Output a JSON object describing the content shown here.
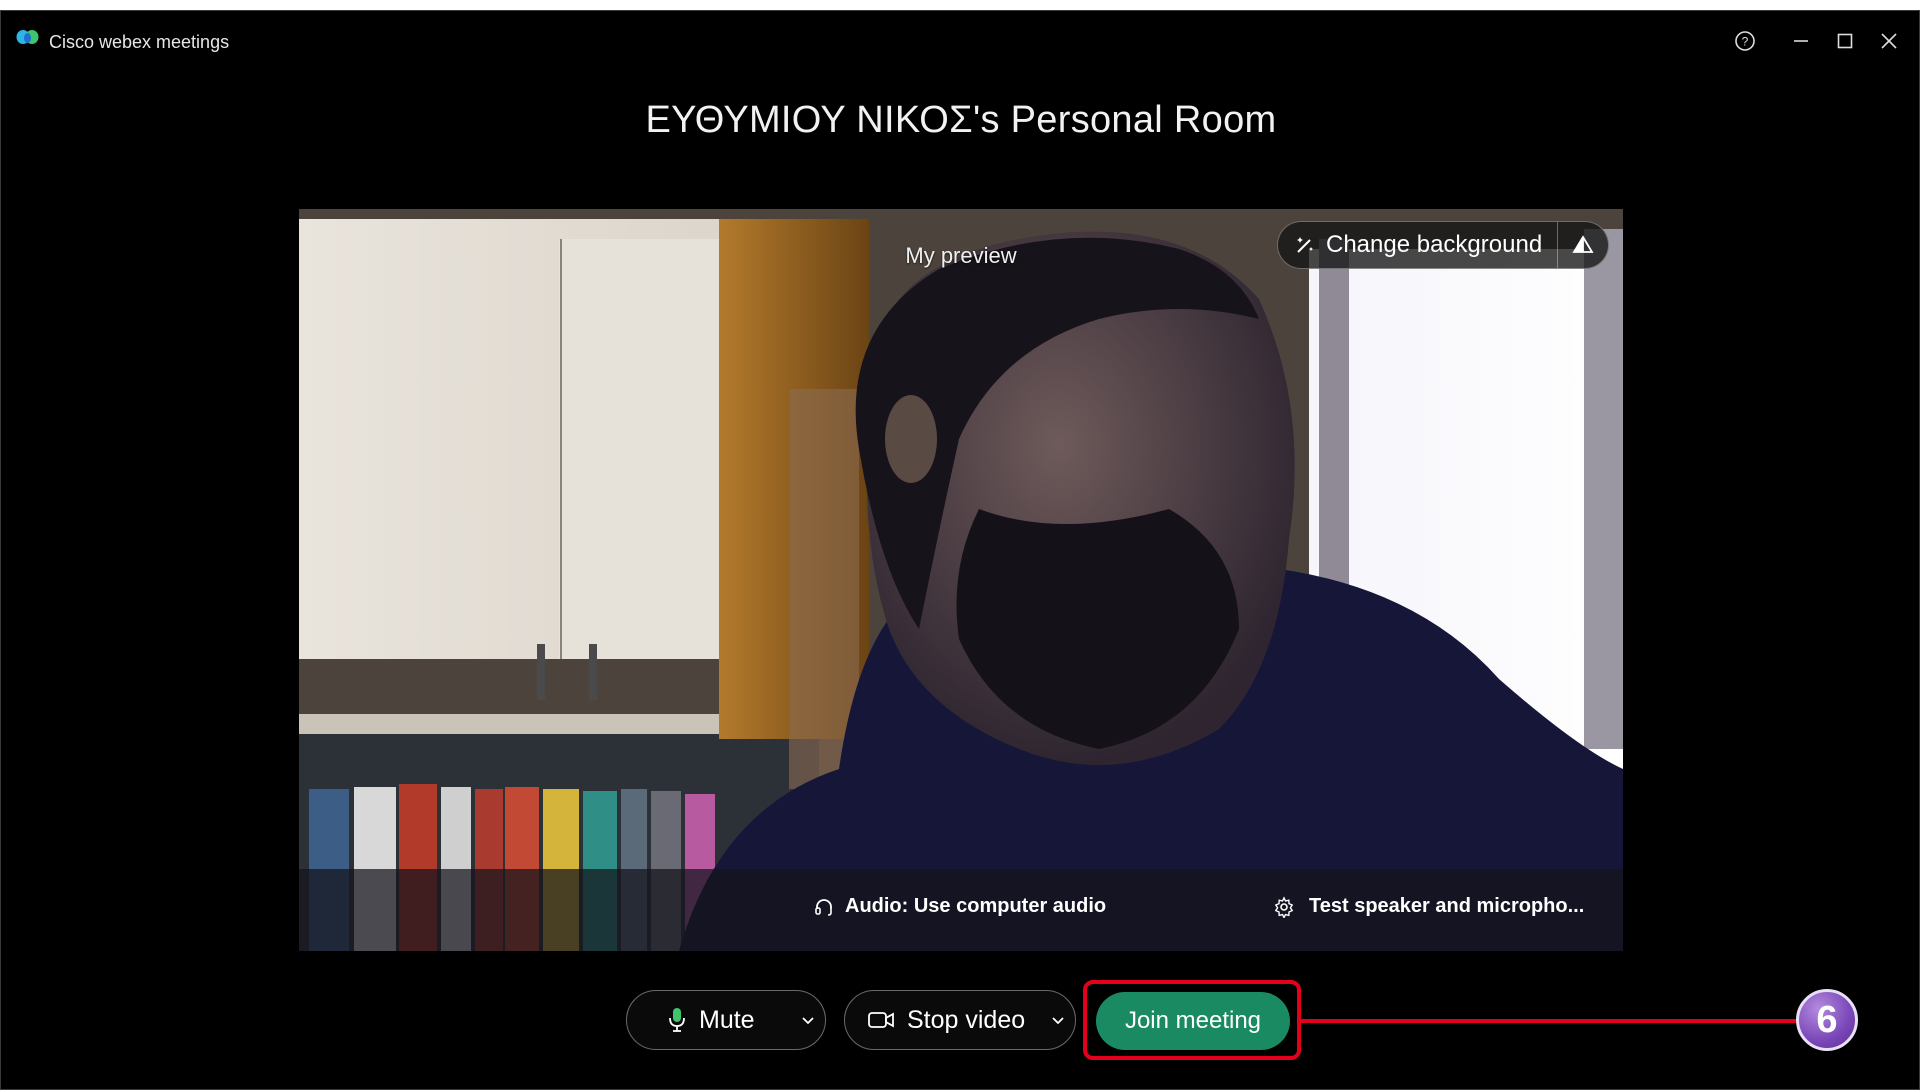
{
  "window": {
    "app_name": "Cisco webex meetings",
    "room_title": "ΕΥΘΥΜΙΟΥ ΝΙΚΟΣ's Personal Room"
  },
  "preview": {
    "label": "My preview",
    "change_background_label": "Change background",
    "audio_label": "Audio: Use computer audio",
    "test_label": "Test speaker and micropho..."
  },
  "controls": {
    "mute_label": "Mute",
    "stop_video_label": "Stop video",
    "join_label": "Join meeting"
  },
  "annotation": {
    "step_number": "6",
    "highlight_color": "#e3001b"
  },
  "colors": {
    "join_button": "#1a8a63",
    "background": "#000000"
  },
  "icons": [
    "webex-logo-icon",
    "help-icon",
    "minimize-icon",
    "maximize-icon",
    "close-icon",
    "magic-wand-icon",
    "background-options-icon",
    "headphones-icon",
    "gear-icon",
    "microphone-icon",
    "chevron-down-icon",
    "video-camera-icon"
  ]
}
